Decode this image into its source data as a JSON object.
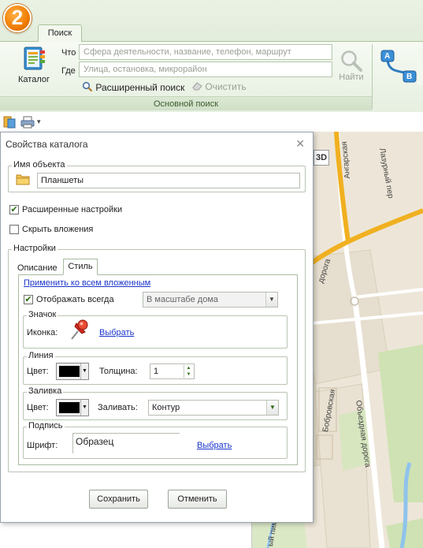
{
  "app": {
    "logo_text": "2"
  },
  "ribbon": {
    "tab_label": "Поиск",
    "catalog_label": "Каталог",
    "what_label": "Что",
    "what_placeholder": "Сфера деятельности, название, телефон, маршрут",
    "where_label": "Где",
    "where_placeholder": "Улица, остановка, микрорайон",
    "advanced_search_label": "Расширенный поиск",
    "clear_label": "Очистить",
    "find_label": "Найти",
    "group_label": "Основной поиск",
    "right_group_letters": [
      "A",
      "B"
    ]
  },
  "map": {
    "button_3d": "3D",
    "streets": [
      "Ангарская",
      "Лазурный пер",
      "дорога",
      "Объездная дорога",
      "Бобровская",
      "ый пим"
    ]
  },
  "dialog": {
    "title": "Свойства каталога",
    "close_icon": "✕",
    "object_name_legend": "Имя объекта",
    "object_name_value": "Планшеты",
    "extended_settings_label": "Расширенные настройки",
    "extended_settings_checked": true,
    "hide_attachments_label": "Скрыть вложения",
    "hide_attachments_checked": false,
    "settings_legend": "Настройки",
    "tabs": [
      {
        "label": "Описание",
        "active": false
      },
      {
        "label": "Стиль",
        "active": true
      }
    ],
    "apply_all_link": "Применить ко всем вложенным",
    "always_show_label": "Отображать всегда",
    "always_show_checked": true,
    "scale_select_value": "В масштабе дома",
    "icon_section": {
      "legend": "Значок",
      "label": "Иконка:",
      "choose_link": "Выбрать",
      "icon": "pushpin-icon"
    },
    "line_section": {
      "legend": "Линия",
      "color_label": "Цвет:",
      "color": "#000000",
      "thickness_label": "Толщина:",
      "thickness_value": "1"
    },
    "fill_section": {
      "legend": "Заливка",
      "color_label": "Цвет:",
      "color": "#000000",
      "fill_label": "Заливать:",
      "fill_value": "Контур"
    },
    "caption_section": {
      "legend": "Подпись",
      "font_label": "Шрифт:",
      "sample_text": "Образец",
      "choose_link": "Выбрать"
    },
    "save_label": "Сохранить",
    "cancel_label": "Отменить"
  },
  "colors": {
    "accent_orange": "#f07d00",
    "ribbon_green": "#dfe9d6",
    "link_blue": "#1a35c9",
    "road_orange": "#f0b020"
  }
}
